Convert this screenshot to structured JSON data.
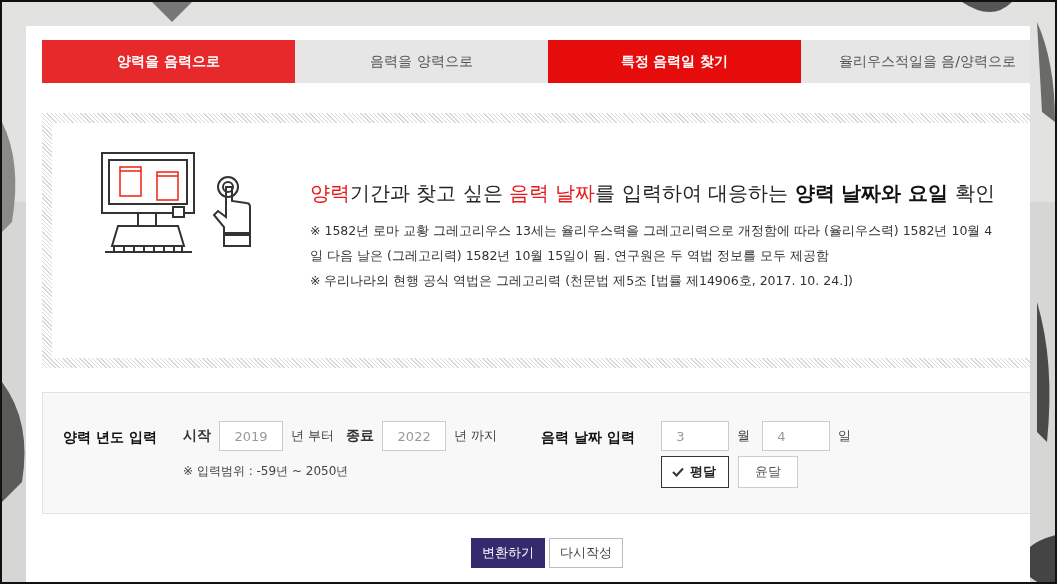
{
  "tabs": [
    {
      "label": "양력을 음력으로",
      "selected": true
    },
    {
      "label": "음력을 양력으로",
      "selected": false
    },
    {
      "label": "특정 음력일 찾기",
      "selected": true
    },
    {
      "label": "율리우스적일을 음/양력으로",
      "selected": false
    }
  ],
  "info": {
    "heading": [
      {
        "kind": "accent",
        "text": "양력"
      },
      {
        "kind": "plain",
        "text": "기간과 찾고 싶은 "
      },
      {
        "kind": "accent",
        "text": "음력 날짜"
      },
      {
        "kind": "plain",
        "text": "를 입력하여 대응하는 "
      },
      {
        "kind": "strong",
        "text": "양력 날짜와 요일"
      },
      {
        "kind": "plain",
        "text": " 확인"
      }
    ],
    "notes": [
      "※ 1582년 로마 교황 그레고리우스 13세는 율리우스력을 그레고리력으로 개정함에 따라 (율리우스력) 1582년 10월 4일 다음 날은 (그레고리력) 1582년 10월 15일이 됨. 연구원은 두 역법 정보를 모두 제공함",
      "※ 우리나라의 현행 공식 역법은 그레고리력 (천문법 제5조 [법률 제14906호, 2017. 10. 24.])"
    ]
  },
  "year_input": {
    "label": "양력 년도 입력",
    "start_label": "시작",
    "start_placeholder": "2019",
    "start_suffix": "년 부터",
    "end_label": "종료",
    "end_placeholder": "2022",
    "end_suffix": "년 까지",
    "hint": "※ 입력범위 : -59년 ~ 2050년"
  },
  "date_input": {
    "label": "음력 날짜 입력",
    "month_placeholder": "3",
    "month_suffix": "월",
    "day_placeholder": "4",
    "day_suffix": "일",
    "month_types": [
      {
        "label": "평달",
        "selected": true
      },
      {
        "label": "윤달",
        "selected": false
      }
    ]
  },
  "buttons": [
    {
      "label": "변환하기",
      "kind": "primary"
    },
    {
      "label": "다시작성",
      "kind": "secondary"
    }
  ]
}
